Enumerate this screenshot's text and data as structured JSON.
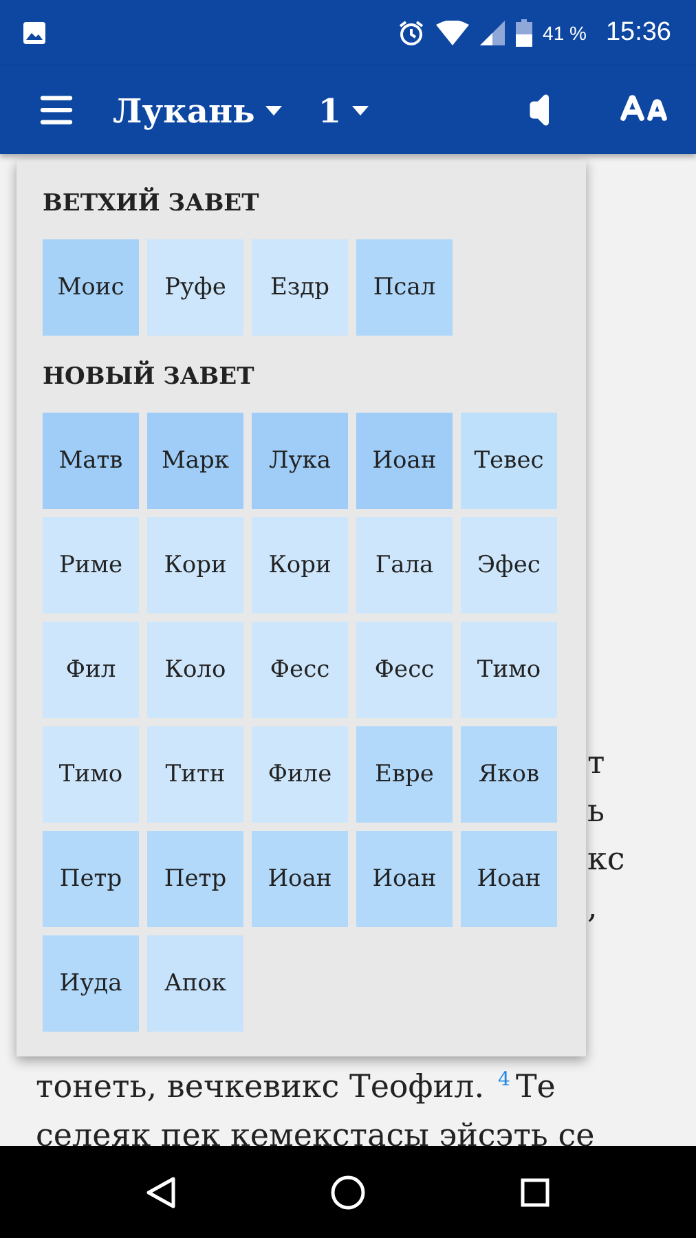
{
  "status_bar": {
    "battery": "41 %",
    "time": "15:36"
  },
  "toolbar": {
    "book": "Лукань",
    "chapter": "1"
  },
  "book_picker": {
    "sections": [
      {
        "title": "ВЕТХИЙ ЗАВЕТ",
        "books": [
          {
            "label": "Моис",
            "color": "#a6d2f8"
          },
          {
            "label": "Руфе",
            "color": "#cde6fb"
          },
          {
            "label": "Ездр",
            "color": "#cde6fb"
          },
          {
            "label": "Псал",
            "color": "#aed7f9"
          }
        ]
      },
      {
        "title": "НОВЫЙ ЗАВЕТ",
        "books": [
          {
            "label": "Матв",
            "color": "#9fcdf7"
          },
          {
            "label": "Марк",
            "color": "#9fcdf7"
          },
          {
            "label": "Лука",
            "color": "#9fcdf7"
          },
          {
            "label": "Иоан",
            "color": "#9fcdf7"
          },
          {
            "label": "Тевес",
            "color": "#bfe0fb"
          },
          {
            "label": "Риме",
            "color": "#cde6fb"
          },
          {
            "label": "Кори",
            "color": "#cde6fb"
          },
          {
            "label": "Кори",
            "color": "#cde6fb"
          },
          {
            "label": "Гала",
            "color": "#cde6fb"
          },
          {
            "label": "Эфес",
            "color": "#cde6fb"
          },
          {
            "label": "Фил",
            "color": "#cde6fb"
          },
          {
            "label": "Коло",
            "color": "#cde6fb"
          },
          {
            "label": "Фесс",
            "color": "#cde6fb"
          },
          {
            "label": "Фесс",
            "color": "#cde6fb"
          },
          {
            "label": "Тимо",
            "color": "#cde6fb"
          },
          {
            "label": "Тимо",
            "color": "#cde6fb"
          },
          {
            "label": "Титн",
            "color": "#cde6fb"
          },
          {
            "label": "Филе",
            "color": "#cde6fb"
          },
          {
            "label": "Евре",
            "color": "#b3d9fa"
          },
          {
            "label": "Яков",
            "color": "#b3d9fa"
          },
          {
            "label": "Петр",
            "color": "#b3d9fa"
          },
          {
            "label": "Петр",
            "color": "#b3d9fa"
          },
          {
            "label": "Иоан",
            "color": "#b3d9fa"
          },
          {
            "label": "Иоан",
            "color": "#b3d9fa"
          },
          {
            "label": "Иоан",
            "color": "#b3d9fa"
          },
          {
            "label": "Иуда",
            "color": "#b3d9fa"
          },
          {
            "label": "Апок",
            "color": "#c6e3fb"
          }
        ]
      }
    ]
  },
  "reader": {
    "line_ends": [
      "т",
      "ь",
      "кс",
      ","
    ],
    "lines": [
      {
        "text": "тонеть, вечкевикс Теофил.",
        "verse": "4",
        "after": "Те"
      },
      {
        "text": "селеяк пек кемекстасы эйсэть се"
      }
    ]
  }
}
